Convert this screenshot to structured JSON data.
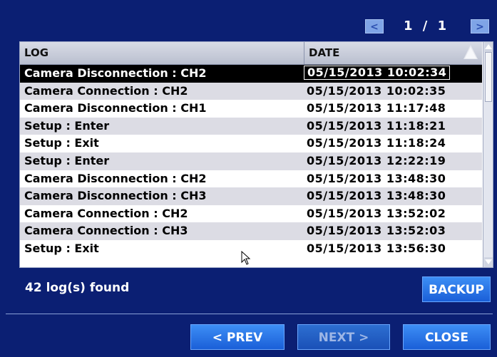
{
  "pager": {
    "prev_icon": "<",
    "page_label": "1 / 1",
    "next_icon": ">"
  },
  "table": {
    "columns": {
      "log": "LOG",
      "date": "DATE"
    },
    "rows": [
      {
        "log": "Camera Disconnection : CH2",
        "date": "05/15/2013 10:02:34"
      },
      {
        "log": "Camera Connection : CH2",
        "date": "05/15/2013 10:02:35"
      },
      {
        "log": "Camera Disconnection : CH1",
        "date": "05/15/2013 11:17:48"
      },
      {
        "log": "Setup : Enter",
        "date": "05/15/2013 11:18:21"
      },
      {
        "log": "Setup : Exit",
        "date": "05/15/2013 11:18:24"
      },
      {
        "log": "Setup : Enter",
        "date": "05/15/2013 12:22:19"
      },
      {
        "log": "Camera Disconnection : CH2",
        "date": "05/15/2013 13:48:30"
      },
      {
        "log": "Camera Disconnection : CH3",
        "date": "05/15/2013 13:48:30"
      },
      {
        "log": "Camera Connection : CH2",
        "date": "05/15/2013 13:52:02"
      },
      {
        "log": "Camera Connection : CH3",
        "date": "05/15/2013 13:52:03"
      },
      {
        "log": "Setup : Exit",
        "date": "05/15/2013 13:56:30"
      }
    ],
    "selected_index": 0
  },
  "status": {
    "count_text": "42 log(s) found"
  },
  "buttons": {
    "backup": "BACKUP",
    "prev": "< PREV",
    "next": "NEXT >",
    "close": "CLOSE"
  },
  "colors": {
    "background": "#0b1f73",
    "button": "#2a74e8",
    "selected_row": "#000000"
  }
}
